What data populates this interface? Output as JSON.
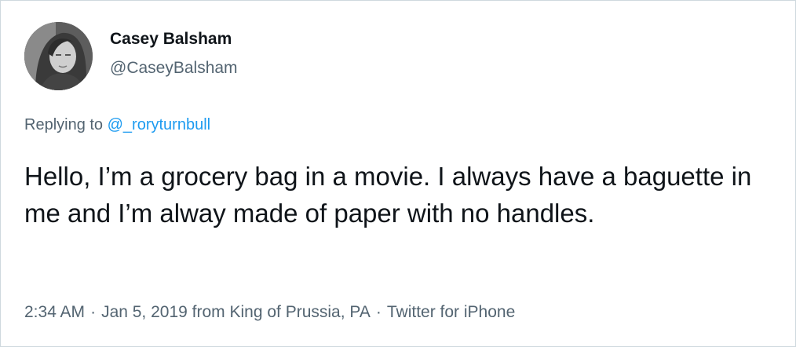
{
  "author": {
    "display_name": "Casey Balsham",
    "handle": "@CaseyBalsham"
  },
  "reply": {
    "prefix": "Replying to",
    "mention": "@_roryturnbull"
  },
  "tweet": {
    "text": "Hello, I’m a grocery bag in a movie. I always have a baguette in me and I’m alway made of paper with no handles."
  },
  "meta": {
    "time": "2:34 AM",
    "separator": "·",
    "date_location": "Jan 5, 2019 from King of Prussia, PA",
    "source": "Twitter for iPhone"
  },
  "colors": {
    "text_primary": "#0f1419",
    "text_secondary": "#536471",
    "link": "#1d9bf0",
    "border": "#cfd9de"
  }
}
